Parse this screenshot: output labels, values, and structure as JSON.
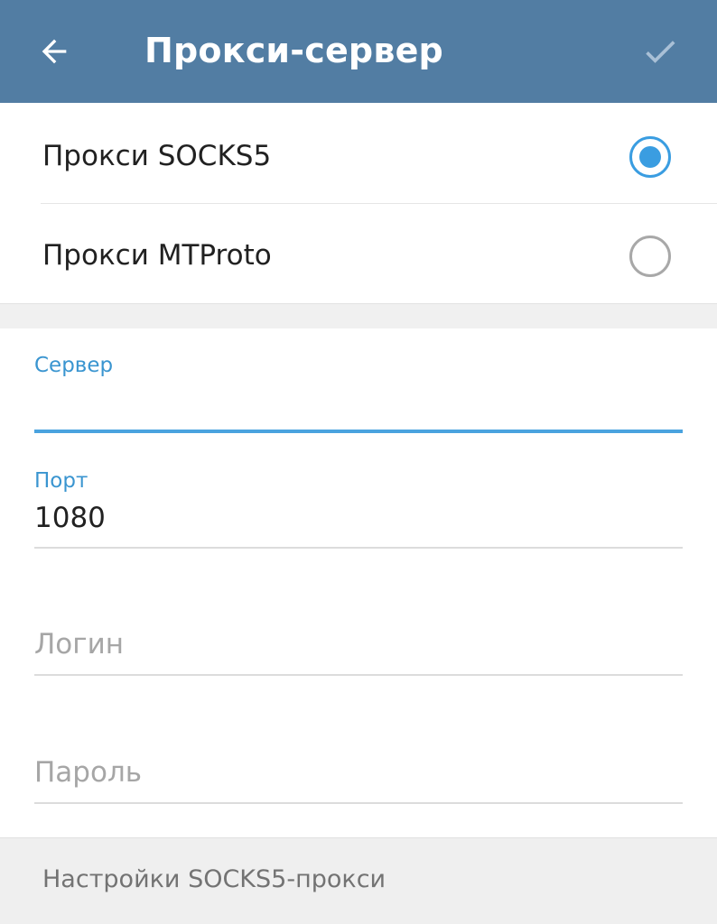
{
  "header": {
    "title": "Прокси-сервер",
    "back_icon": "arrow-left-icon",
    "done_icon": "checkmark-icon",
    "background_color": "#527da3"
  },
  "proxy_types": [
    {
      "label": "Прокси SOCKS5",
      "selected": true
    },
    {
      "label": "Прокси MTProto",
      "selected": false
    }
  ],
  "form": {
    "server": {
      "label": "Сервер",
      "value": ""
    },
    "port": {
      "label": "Порт",
      "value": "1080"
    },
    "login": {
      "placeholder": "Логин",
      "value": ""
    },
    "password": {
      "placeholder": "Пароль",
      "value": ""
    }
  },
  "footer": {
    "text": "Настройки SOCKS5-прокси"
  },
  "colors": {
    "accent": "#3a9de1",
    "field_active": "#4aa3df"
  }
}
